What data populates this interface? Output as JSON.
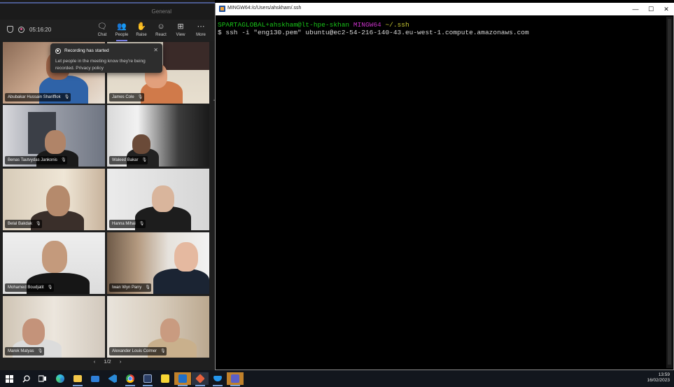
{
  "teams": {
    "window_title": "General",
    "timer": "05:16:20",
    "toolbar": [
      {
        "label": "Chat",
        "icon": "chat-icon"
      },
      {
        "label": "People",
        "icon": "people-icon",
        "active": true
      },
      {
        "label": "Raise",
        "icon": "raise-hand-icon"
      },
      {
        "label": "React",
        "icon": "react-icon"
      },
      {
        "label": "View",
        "icon": "view-icon"
      },
      {
        "label": "More",
        "icon": "more-icon"
      }
    ],
    "toast": {
      "title": "Recording has started",
      "body": "Let people in the meeting know they're being recorded. Privacy policy"
    },
    "participants": [
      "Abubakar Hussain Sharifflok",
      "James Cole",
      "Benas Tautvydas Jankonis",
      "Waleed Bakar",
      "Belal Bakdak",
      "Hanna Mihai",
      "Mohamed Boudjatit",
      "Iwan Wyn Parry",
      "Marek Matyas",
      "Alexander Louis Colmer"
    ],
    "pager": {
      "prev": "‹",
      "label": "1/2",
      "next": "›"
    }
  },
  "terminal": {
    "title": "MINGW64:/c/Users/ahskham/.ssh",
    "prompt_user": "SPARTAGLOBAL+ahskham@lt-hpe-skhan",
    "prompt_env": "MINGW64",
    "prompt_path": "~/.ssh",
    "command": "$ ssh -i \"eng130.pem\" ubuntu@ec2-54-216-140-43.eu-west-1.compute.amazonaws.com",
    "window_buttons": {
      "minimize": "—",
      "maximize": "☐",
      "close": "✕"
    }
  },
  "taskbar": {
    "time": "13:59",
    "date": "16/02/2023"
  },
  "colors": {
    "teams_accent": "#7b83eb",
    "terminal_green": "#19c219",
    "terminal_magenta": "#c832c8",
    "terminal_yellow": "#c8c832",
    "taskbar_highlight": "#c0812b"
  }
}
